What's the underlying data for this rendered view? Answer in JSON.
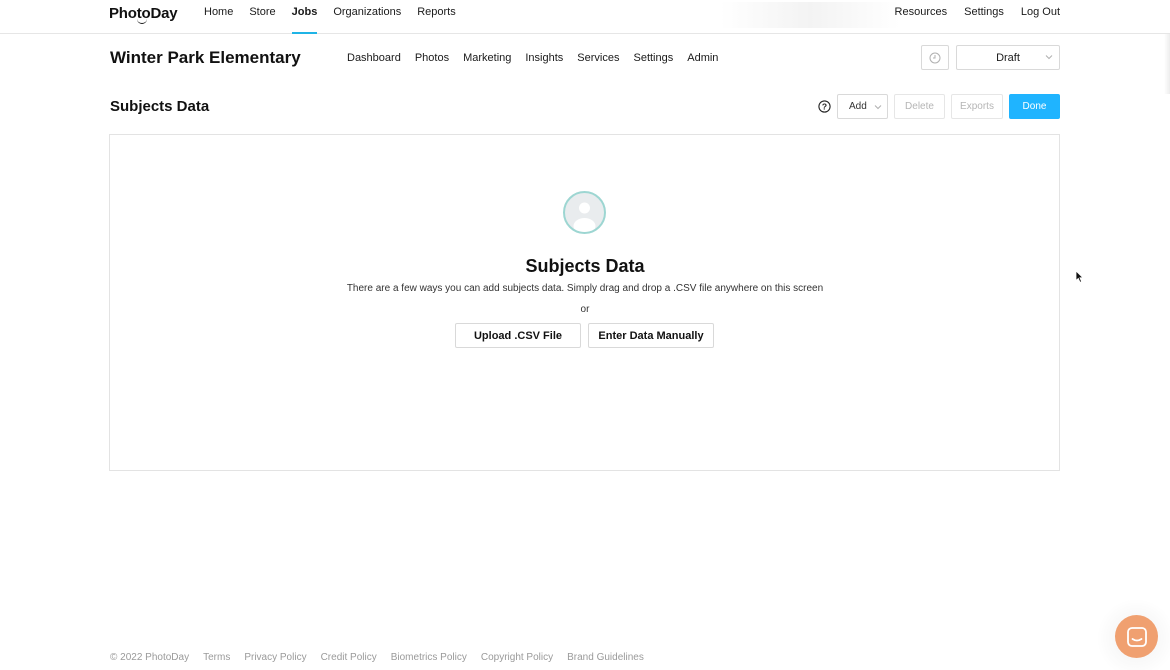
{
  "app": {
    "logo_text": "PhotoDay"
  },
  "topnav": {
    "items": [
      {
        "label": "Home",
        "active": false
      },
      {
        "label": "Store",
        "active": false
      },
      {
        "label": "Jobs",
        "active": true
      },
      {
        "label": "Organizations",
        "active": false
      },
      {
        "label": "Reports",
        "active": false
      }
    ],
    "right_items": [
      "Resources",
      "Settings",
      "Log Out"
    ]
  },
  "job": {
    "title": "Winter Park Elementary",
    "tabs": [
      "Dashboard",
      "Photos",
      "Marketing",
      "Insights",
      "Services",
      "Settings",
      "Admin"
    ],
    "status": "Draft"
  },
  "section": {
    "title": "Subjects Data",
    "add_label": "Add",
    "delete_label": "Delete",
    "exports_label": "Exports",
    "done_label": "Done"
  },
  "panel": {
    "title": "Subjects Data",
    "description": "There are a few ways you can add subjects data. Simply drag and drop a .CSV file anywhere on this screen",
    "or_text": "or",
    "upload_label": "Upload .CSV File",
    "manual_label": "Enter Data Manually"
  },
  "footer": {
    "copyright": "© 2022 PhotoDay",
    "links": [
      "Terms",
      "Privacy Policy",
      "Credit Policy",
      "Biometrics Policy",
      "Copyright Policy",
      "Brand Guidelines"
    ]
  },
  "colors": {
    "accent": "#1fb4ff",
    "chat": "#f0a070"
  },
  "icons": [
    "clock-icon",
    "chevron-down-icon",
    "help-icon",
    "user-avatar-icon",
    "cursor-icon",
    "chat-icon"
  ]
}
